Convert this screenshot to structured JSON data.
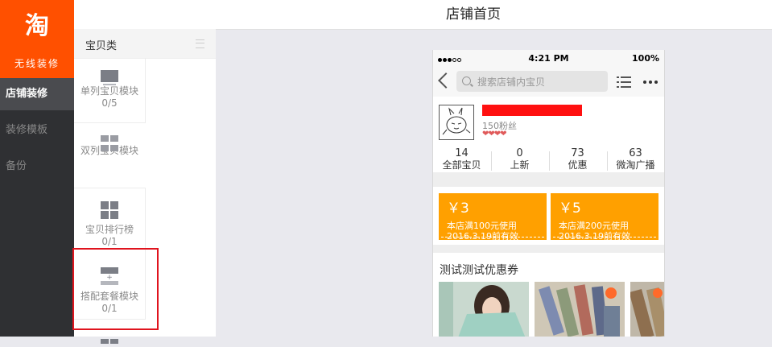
{
  "brand": {
    "logo_glyph": "淘",
    "subtitle": "无线装修"
  },
  "nav": {
    "items": [
      {
        "label": "店铺装修",
        "active": true
      },
      {
        "label": "装修模板",
        "active": false
      },
      {
        "label": "备份",
        "active": false
      }
    ]
  },
  "module_panel": {
    "title": "宝贝类",
    "modules": [
      {
        "label": "单列宝贝模块",
        "count": "0/5"
      },
      {
        "label": "双列宝贝模块",
        "count": ""
      },
      {
        "label": "宝贝排行榜",
        "count": "0/1"
      },
      {
        "label": "搭配套餐模块",
        "count": "0/1"
      }
    ]
  },
  "header": {
    "title": "店铺首页"
  },
  "phone": {
    "status_bar": {
      "time": "4:21 PM",
      "battery": "100%"
    },
    "search_placeholder": "搜索店铺内宝贝",
    "shop": {
      "fans": "150粉丝",
      "hearts": "❤❤❤❤",
      "stats": [
        {
          "value": "14",
          "label": "全部宝贝"
        },
        {
          "value": "0",
          "label": "上新"
        },
        {
          "value": "73",
          "label": "优惠"
        },
        {
          "value": "63",
          "label": "微淘广播"
        }
      ]
    },
    "coupons": [
      {
        "amount": "￥3",
        "condition": "本店满100元使用",
        "validity": "2016.3.19前有效"
      },
      {
        "amount": "￥5",
        "condition": "本店满200元使用",
        "validity": "2016.3.19前有效"
      }
    ],
    "section_title": "测试测试优惠券"
  },
  "colors": {
    "brand": "#ff5000",
    "coupon": "#ffa000",
    "nav_bg": "#2f3033",
    "highlight": "#e0141e"
  }
}
